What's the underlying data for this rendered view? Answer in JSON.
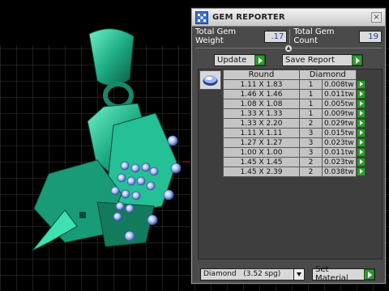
{
  "panel": {
    "title": "GEM REPORTER",
    "close_label": "×",
    "totals": {
      "weight_label": "Total Gem Weight",
      "weight_value": ".17",
      "count_label": "Total Gem Count",
      "count_value": "19"
    },
    "buttons": {
      "update_label": "Update",
      "save_report_label": "Save Report",
      "set_material_label": "Set Material"
    },
    "table": {
      "headers": [
        "Round",
        "Diamond"
      ],
      "rows": [
        {
          "size": "1.11 X 1.83",
          "count": "1",
          "weight": "0.008tw"
        },
        {
          "size": "1.46 X 1.46",
          "count": "1",
          "weight": "0.011tw"
        },
        {
          "size": "1.08 X 1.08",
          "count": "1",
          "weight": "0.005tw"
        },
        {
          "size": "1.33 X 1.33",
          "count": "1",
          "weight": "0.009tw"
        },
        {
          "size": "1.33 X 2.20",
          "count": "2",
          "weight": "0.029tw"
        },
        {
          "size": "1.11 X 1.11",
          "count": "3",
          "weight": "0.015tw"
        },
        {
          "size": "1.27 X 1.27",
          "count": "3",
          "weight": "0.023tw"
        },
        {
          "size": "1.00 X 1.00",
          "count": "3",
          "weight": "0.011tw"
        },
        {
          "size": "1.45 X 1.45",
          "count": "2",
          "weight": "0.023tw"
        },
        {
          "size": "1.45 X 2.39",
          "count": "2",
          "weight": "0.038tw"
        }
      ]
    },
    "material_select": {
      "value": "Diamond",
      "spg": "(3.52 spg)"
    }
  },
  "icons": {
    "app": "gem-reporter-icon",
    "go": "play-arrow-icon",
    "thumb": "round-gem-icon"
  },
  "colors": {
    "model": "#1fae86",
    "gem": "#9bb6ee",
    "accent_green": "#2f9a2f"
  }
}
